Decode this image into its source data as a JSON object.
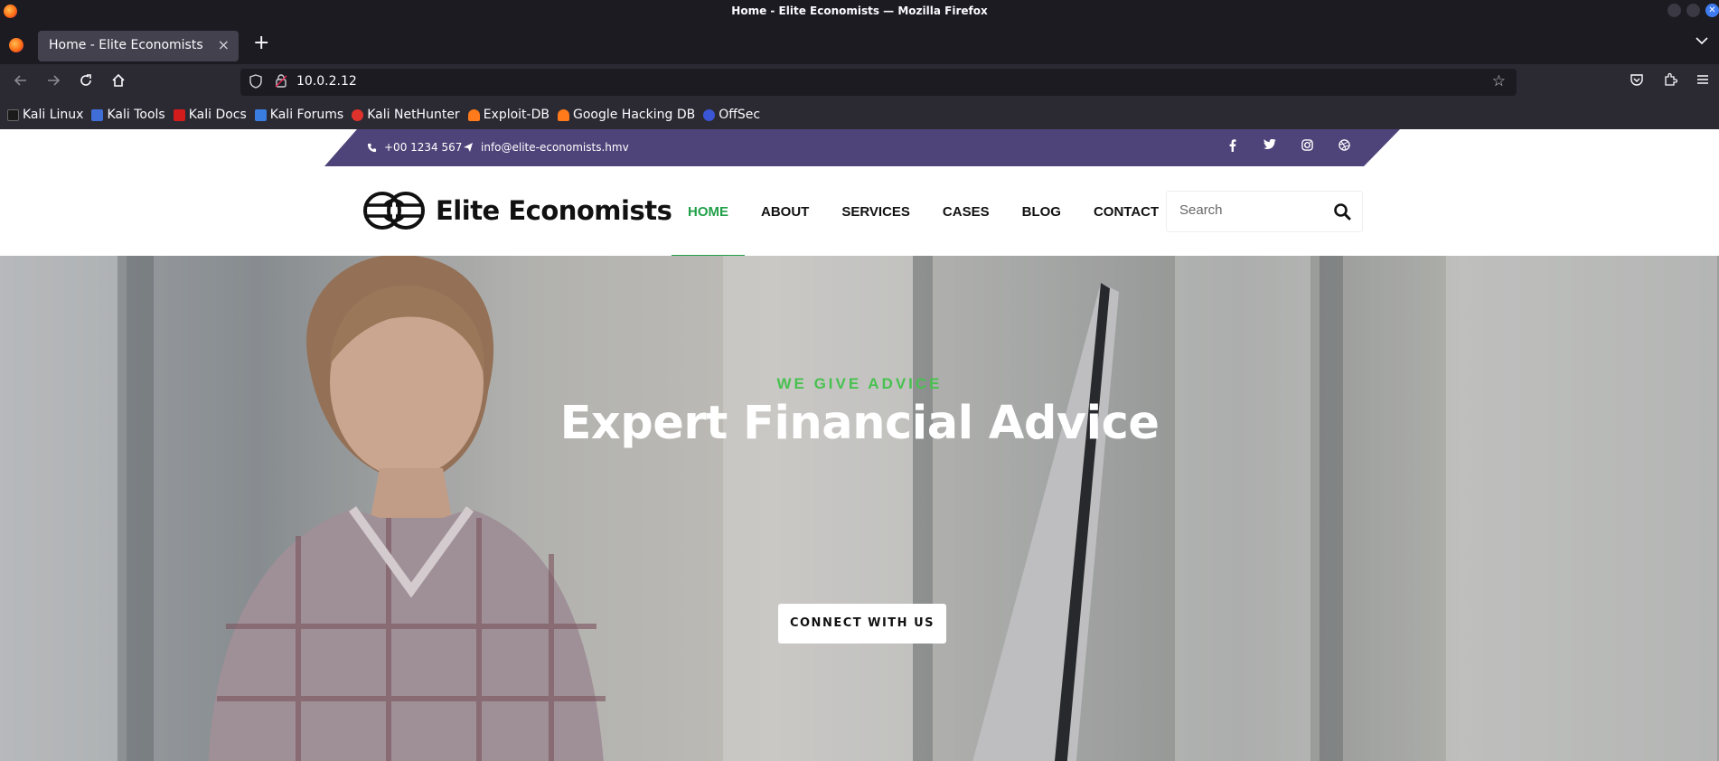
{
  "window": {
    "title": "Home - Elite Economists — Mozilla Firefox"
  },
  "tabs": [
    {
      "label": "Home - Elite Economists"
    }
  ],
  "address_bar": {
    "url": "10.0.2.12"
  },
  "bookmarks": [
    {
      "label": "Kali Linux",
      "icon": "kali-dragon-icon",
      "color": "#1b1b1b"
    },
    {
      "label": "Kali Tools",
      "icon": "kali-tools-icon",
      "color": "#3f6ed8"
    },
    {
      "label": "Kali Docs",
      "icon": "kali-docs-icon",
      "color": "#d41c1c"
    },
    {
      "label": "Kali Forums",
      "icon": "kali-forums-icon",
      "color": "#3a7de0"
    },
    {
      "label": "Kali NetHunter",
      "icon": "nethunter-icon",
      "color": "#e0322c"
    },
    {
      "label": "Exploit-DB",
      "icon": "exploit-db-icon",
      "color": "#ff7a1a"
    },
    {
      "label": "Google Hacking DB",
      "icon": "ghdb-icon",
      "color": "#ff7a1a"
    },
    {
      "label": "OffSec",
      "icon": "offsec-icon",
      "color": "#3a56d6"
    }
  ],
  "site": {
    "topbar": {
      "phone": "+00 1234 567",
      "email": "info@elite-economists.hmv",
      "social": [
        "facebook-icon",
        "twitter-icon",
        "instagram-icon",
        "dribbble-icon"
      ]
    },
    "brand": {
      "name": "Elite Economists"
    },
    "menu": [
      "HOME",
      "ABOUT",
      "SERVICES",
      "CASES",
      "BLOG",
      "CONTACT"
    ],
    "active_menu": "HOME",
    "search": {
      "placeholder": "Search"
    },
    "hero": {
      "subtitle": "WE GIVE ADVICE",
      "title": "Expert Financial Advice",
      "button": "CONNECT WITH US"
    },
    "colors": {
      "accent": "#21a049",
      "topbar": "#4e4479"
    }
  }
}
